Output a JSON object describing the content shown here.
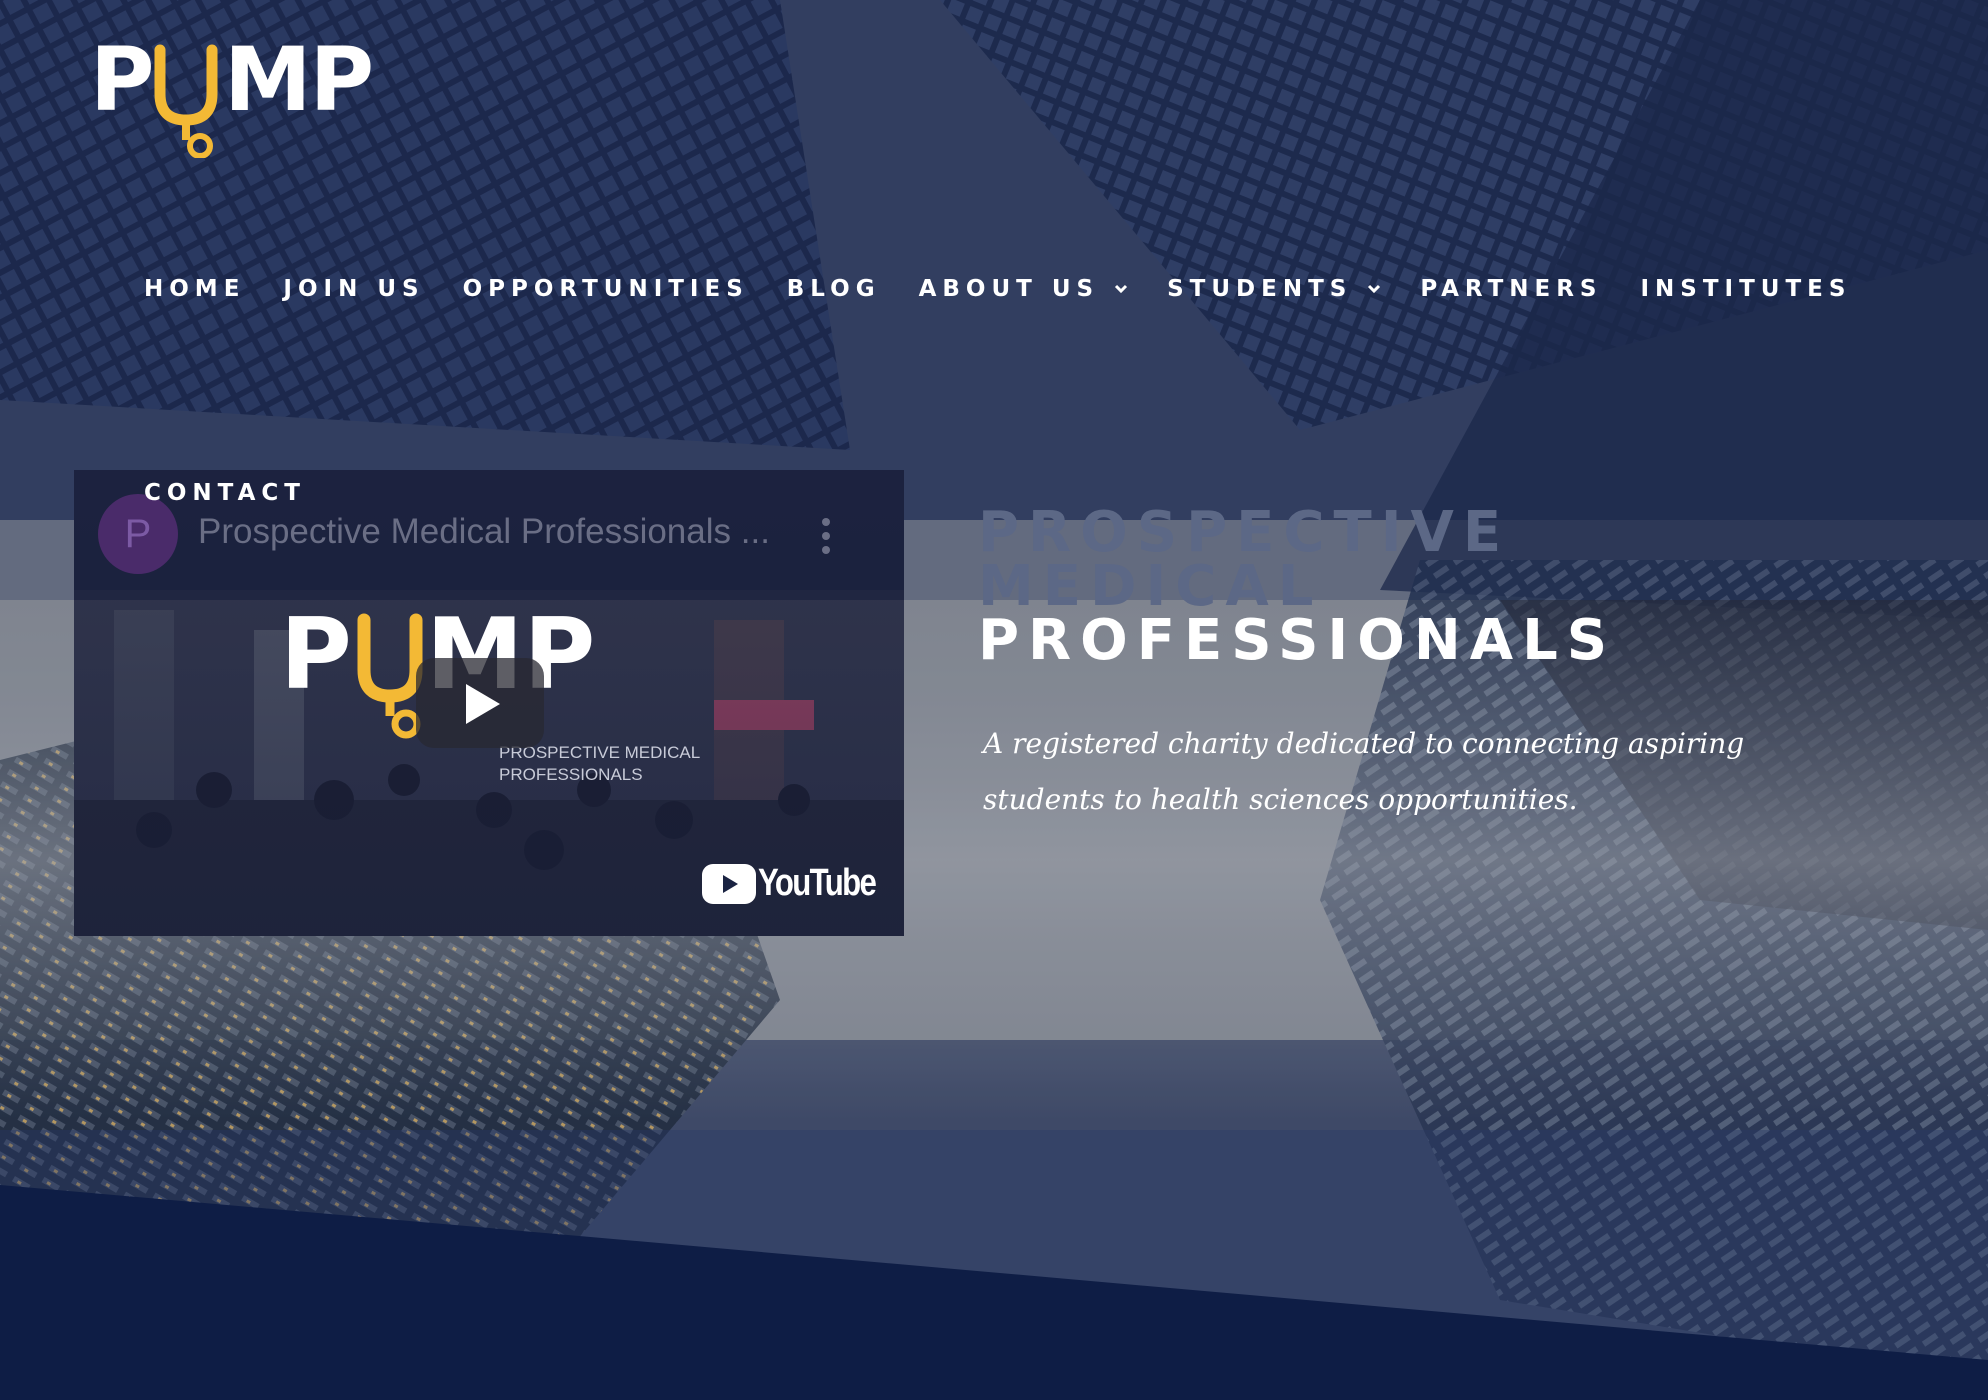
{
  "brand": {
    "logo_text": "PUMP",
    "accent_color": "#f3b935",
    "navy_color": "#0e1d45"
  },
  "nav": {
    "items": [
      {
        "label": "HOME",
        "has_dropdown": false
      },
      {
        "label": "JOIN US",
        "has_dropdown": false
      },
      {
        "label": "OPPORTUNITIES",
        "has_dropdown": false
      },
      {
        "label": "BLOG",
        "has_dropdown": false
      },
      {
        "label": "ABOUT US",
        "has_dropdown": true
      },
      {
        "label": "STUDENTS",
        "has_dropdown": true
      },
      {
        "label": "PARTNERS",
        "has_dropdown": false
      },
      {
        "label": "INSTITUTES",
        "has_dropdown": false
      }
    ],
    "contact_label": "CONTACT"
  },
  "video": {
    "channel_initial": "P",
    "title": "Prospective Medical Professionals ...",
    "thumb_logo_text": "PUMP",
    "thumb_subtitle_1": "PROSPECTIVE MEDICAL",
    "thumb_subtitle_2": "PROFESSIONALS",
    "platform_label": "YouTube",
    "menu_icon": "more-vert-icon",
    "play_icon": "play-icon"
  },
  "hero": {
    "headline_line1": "PROSPECTIVE",
    "headline_line2": "MEDICAL",
    "headline_line3": "PROFESSIONALS",
    "tagline": "A registered charity dedicated to connecting aspiring students to health sciences opportunities."
  }
}
